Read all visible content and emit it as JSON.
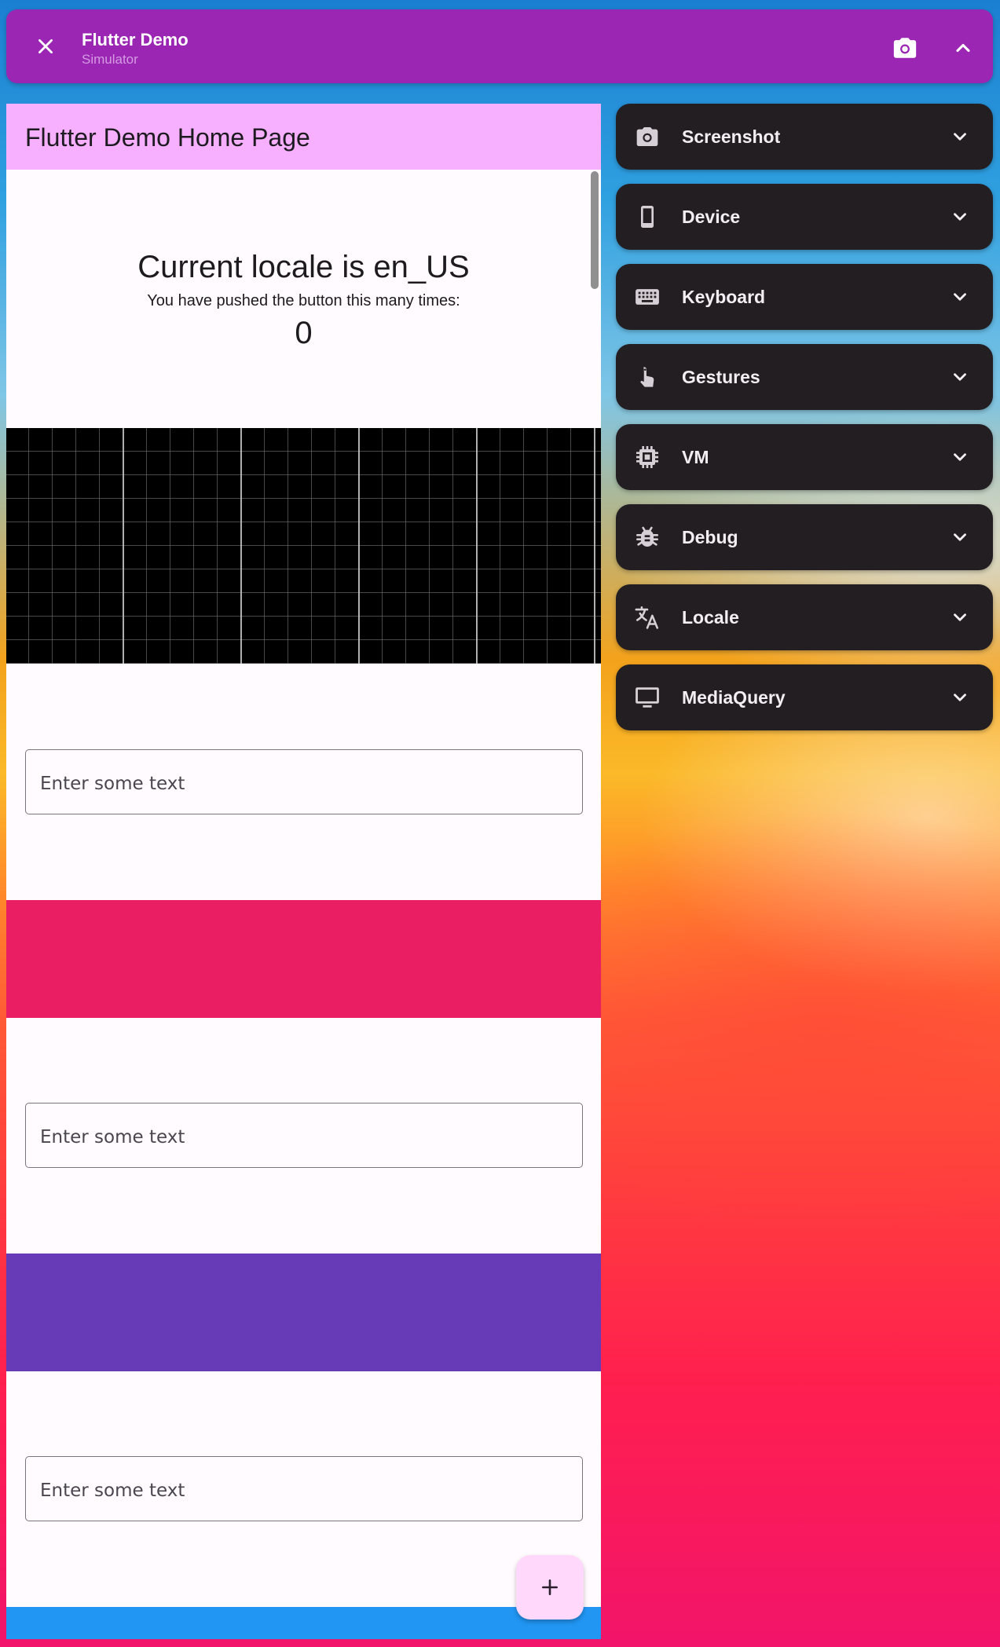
{
  "window": {
    "title": "Flutter Demo",
    "subtitle": "Simulator",
    "icons": {
      "close": "close-icon",
      "screenshot": "camera-icon",
      "collapse": "chevron-up-icon"
    },
    "bar_color": "#9b26b3"
  },
  "app": {
    "page_title": "Flutter Demo Home Page",
    "locale_text": "Current locale is en_US",
    "pushed_text": "You have pushed the button this many times:",
    "counter": "0",
    "text_fields": [
      {
        "placeholder": "Enter some text",
        "value": ""
      },
      {
        "placeholder": "Enter some text",
        "value": ""
      },
      {
        "placeholder": "Enter some text",
        "value": ""
      }
    ],
    "colors": {
      "appbar": "#f7b0ff",
      "band_pink": "#e91e63",
      "band_purple": "#673ab7",
      "band_blue": "#2196f3",
      "fab": "#ffd8fb"
    },
    "fab_icon": "plus-icon"
  },
  "panels": [
    {
      "label": "Screenshot",
      "icon": "camera-icon"
    },
    {
      "label": "Device",
      "icon": "phone-icon"
    },
    {
      "label": "Keyboard",
      "icon": "keyboard-icon"
    },
    {
      "label": "Gestures",
      "icon": "touch-icon"
    },
    {
      "label": "VM",
      "icon": "chip-icon"
    },
    {
      "label": "Debug",
      "icon": "bug-icon"
    },
    {
      "label": "Locale",
      "icon": "translate-icon"
    },
    {
      "label": "MediaQuery",
      "icon": "monitor-icon"
    }
  ]
}
